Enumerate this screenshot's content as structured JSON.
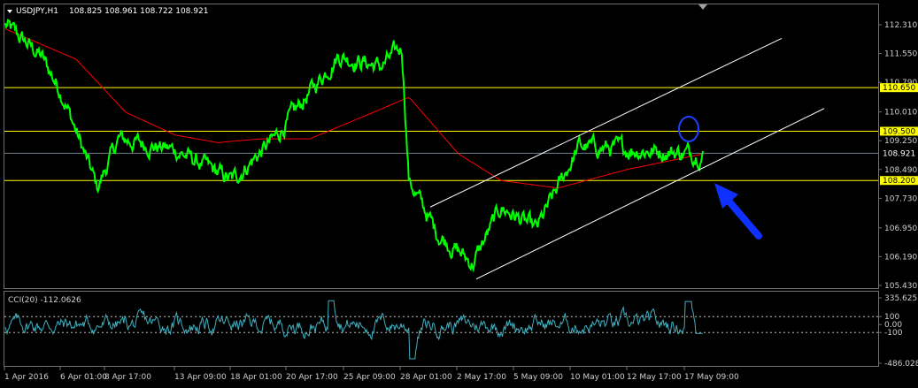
{
  "header": {
    "symbol_label": "USDJPY,H1",
    "ohlc": "108.825 108.961 108.722 108.921"
  },
  "colors": {
    "background": "#000000",
    "price_line": "#00ff00",
    "moving_average": "#ff0000",
    "channel": "#ffffff",
    "level": "#ffff00",
    "current_price_line": "#708090",
    "cci": "#40b0c0",
    "circle": "#2040ff",
    "arrow": "#1030ff",
    "label_text": "#000000",
    "axis_text": "#d0d0d0"
  },
  "price_axis": {
    "ticks": [
      "112.310",
      "111.550",
      "110.790",
      "110.010",
      "109.250",
      "108.490",
      "107.730",
      "106.950",
      "106.190",
      "105.430"
    ]
  },
  "horizontal_levels": [
    {
      "label": "110.650",
      "value": 110.65
    },
    {
      "label": "109.500",
      "value": 109.5
    },
    {
      "label": "108.200",
      "value": 108.2
    }
  ],
  "current_price": {
    "label": "108.921",
    "value": 108.921
  },
  "cci_panel": {
    "label": "CCI(20) -112.0626",
    "ticks": [
      "335.6251",
      "100",
      "0.00",
      "-100",
      "-486.0281"
    ],
    "levels": [
      100,
      -100
    ]
  },
  "time_axis": {
    "labels": [
      "1 Apr 2016",
      "6 Apr 01:00",
      "8 Apr 17:00",
      "13 Apr 09:00",
      "18 Apr 01:00",
      "20 Apr 17:00",
      "25 Apr 09:00",
      "28 Apr 01:00",
      "2 May 17:00",
      "5 May 09:00",
      "10 May 01:00",
      "12 May 17:00",
      "17 May 09:00"
    ]
  },
  "chart_data": {
    "type": "line",
    "symbol": "USDJPY",
    "timeframe": "H1",
    "x": [
      "1 Apr 2016",
      "6 Apr 01:00",
      "8 Apr 17:00",
      "13 Apr 09:00",
      "18 Apr 01:00",
      "20 Apr 17:00",
      "25 Apr 09:00",
      "28 Apr 01:00",
      "2 May 17:00",
      "5 May 09:00",
      "10 May 01:00",
      "12 May 17:00",
      "17 May 09:00"
    ],
    "ylim": [
      105.43,
      112.31
    ],
    "series": [
      {
        "values": [
          112.3,
          111.5,
          110.5,
          108.0,
          109.3,
          109.0,
          108.2,
          109.3,
          111.5,
          111.2,
          111.7,
          108.2,
          106.8,
          106.0,
          107.5,
          106.9,
          109.1,
          109.0,
          108.9
        ]
      },
      {
        "values": [
          112.2,
          111.4,
          110.0,
          109.4,
          109.2,
          109.3,
          109.3,
          110.0,
          110.4,
          108.9,
          108.2,
          108.0,
          108.5,
          108.9
        ]
      },
      {
        "values": [
          335.6,
          100,
          0,
          -100,
          -486.0,
          -112.06
        ]
      }
    ],
    "annotations": [
      "110.650",
      "109.500",
      "108.200"
    ]
  }
}
